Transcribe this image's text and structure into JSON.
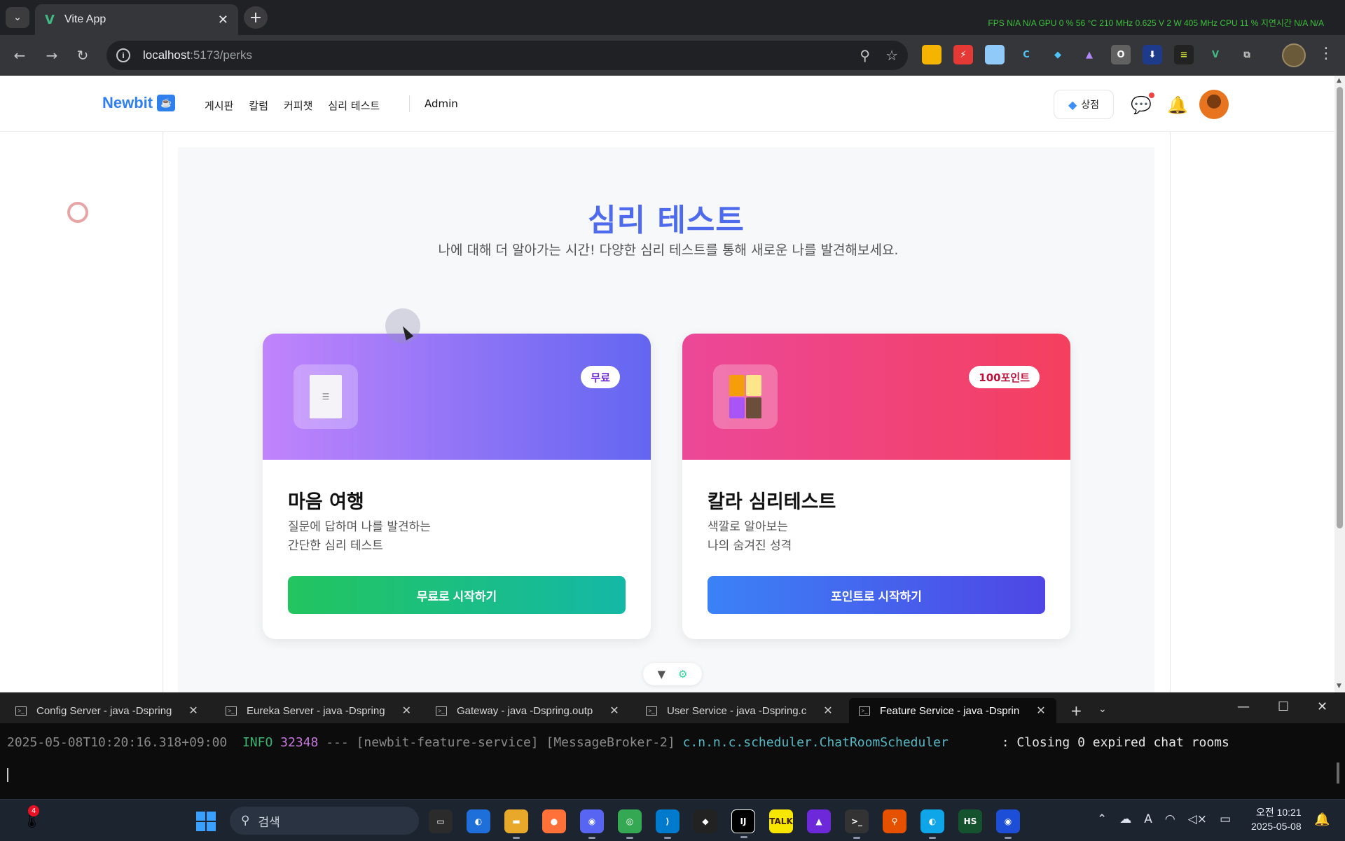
{
  "browser": {
    "tab_title": "Vite App",
    "tab_close": "✕",
    "new_tab": "+",
    "tab_menu": "⌄",
    "url_host": "localhost",
    "url_path": ":5173/perks",
    "hud": "FPS N/A N/A GPU 0 % 56 °C 210 MHz 0.625 V 2 W 405 MHz CPU 11 % 지연시간 N/A N/A"
  },
  "site": {
    "brand": "Newbit",
    "nav": [
      "게시판",
      "칼럼",
      "커피챗",
      "심리 테스트"
    ],
    "admin": "Admin",
    "shop_label": "상점"
  },
  "main": {
    "title": "심리 테스트",
    "subtitle": "나에 대해 더 알아가는 시간! 다양한 심리 테스트를 통해 새로운 나를 발견해보세요.",
    "cards": [
      {
        "badge": "무료",
        "title": "마음 여행",
        "desc_line1": "질문에 답하며 나를 발견하는",
        "desc_line2": "간단한 심리 테스트",
        "cta": "무료로 시작하기"
      },
      {
        "badge": "100포인트",
        "title": "칼라 심리테스트",
        "desc_line1": "색깔로 알아보는",
        "desc_line2": "나의 숨겨진 성격",
        "cta": "포인트로 시작하기"
      }
    ]
  },
  "terminal": {
    "tabs": [
      "Config Server - java  -Dspring",
      "Eureka Server - java  -Dspring",
      "Gateway - java  -Dspring.outp",
      "User Service - java  -Dspring.c",
      "Feature Service - java  -Dsprin"
    ],
    "log": {
      "timestamp": "2025-05-08T10:20:16.318+09:00",
      "level": "INFO",
      "pid": "32348",
      "sep": "---",
      "thread": "[newbit-feature-service] [MessageBroker-2]",
      "logger": "c.n.n.c.scheduler.ChatRoomScheduler",
      "message": ": Closing 0 expired chat rooms"
    }
  },
  "taskbar": {
    "search_label": "검색",
    "notif_count": "4",
    "time": "오전 10:21",
    "date": "2025-05-08"
  },
  "colors": {
    "brand": "#2f80ed",
    "title": "#4f6bed",
    "card1_gradient": [
      "#c084fc",
      "#6366f1"
    ],
    "card2_gradient": [
      "#ec4899",
      "#f43f5e"
    ],
    "cta1_gradient": [
      "#22c55e",
      "#14b8a6"
    ],
    "cta2_gradient": [
      "#3b82f6",
      "#4f46e5"
    ]
  }
}
